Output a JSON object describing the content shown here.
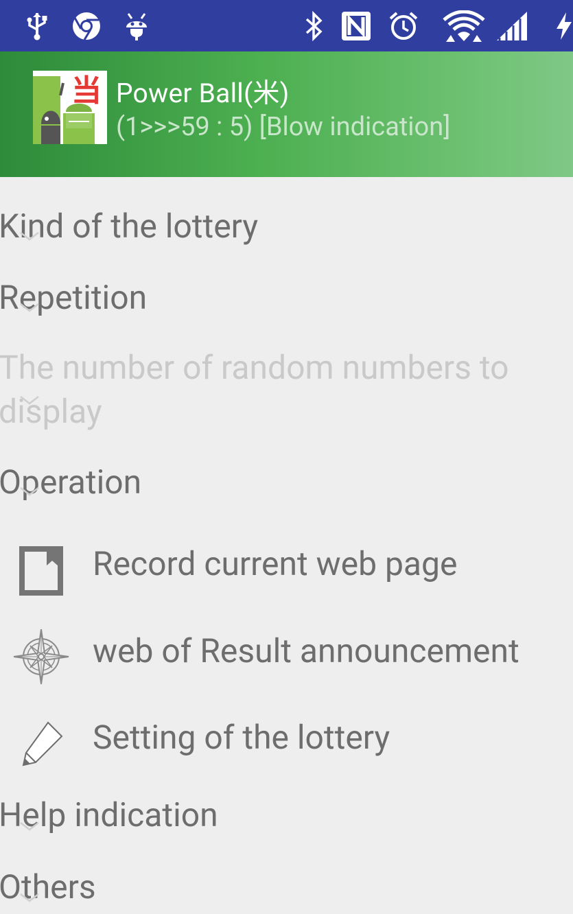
{
  "status_bar": {
    "icons": [
      "usb-icon",
      "chrome-icon",
      "android-debug-icon",
      "bluetooth-icon",
      "nfc-icon",
      "alarm-icon",
      "wifi-icon",
      "signal-icon",
      "charging-icon"
    ]
  },
  "header": {
    "title": "Power Ball(米)",
    "subtitle": "(1>>>59 : 5) [Blow indication]",
    "icon_badge": "当"
  },
  "preferences": {
    "kind": "Kind of the lottery",
    "repetition": "Repetition",
    "random_count": "The number of random numbers to display",
    "operation": "Operation",
    "operation_items": [
      {
        "label": "Record current web page",
        "icon": "bookmark-icon"
      },
      {
        "label": "web of Result announcement",
        "icon": "compass-icon"
      },
      {
        "label": "Setting of the lottery",
        "icon": "pencil-icon"
      }
    ],
    "help": "Help indication",
    "others": "Others"
  },
  "colors": {
    "status_bar": "#303f9f",
    "header_start": "#2e8b3a",
    "header_end": "#7fc887",
    "text": "#6d6d6d",
    "disabled_text": "#c9c9c9",
    "background": "#eeeeee"
  }
}
